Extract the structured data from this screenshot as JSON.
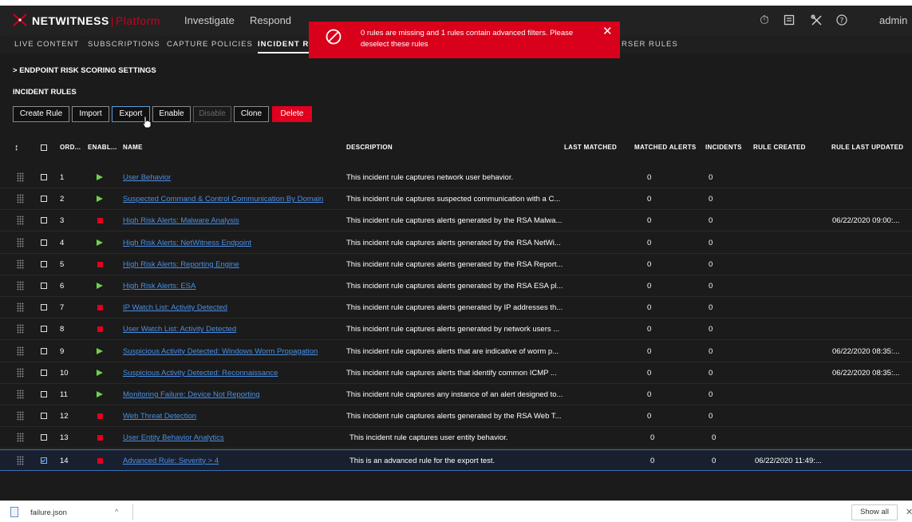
{
  "topnav": {
    "brand": "NETWITNESS",
    "brand_sep": "|",
    "brand_suffix": "Platform",
    "items": [
      "Investigate",
      "Respond"
    ],
    "user": "admin"
  },
  "subnav": {
    "items": [
      {
        "label": "LIVE CONTENT",
        "active": false
      },
      {
        "label": "SUBSCRIPTIONS",
        "active": false
      },
      {
        "label": "CAPTURE POLICIES",
        "active": false
      },
      {
        "label": "INCIDENT RULES",
        "active": true
      },
      {
        "label": "RSER RULES",
        "active": false
      }
    ]
  },
  "toast": {
    "message": "0 rules are missing and 1 rules contain advanced filters. Please deselect these rules",
    "color": "#d9001b"
  },
  "section": {
    "endpoint_link": "ENDPOINT RISK SCORING SETTINGS",
    "title": "INCIDENT RULES"
  },
  "toolbar": {
    "create": "Create Rule",
    "import": "Import",
    "export": "Export",
    "enable": "Enable",
    "disable": "Disable",
    "clone": "Clone",
    "delete": "Delete"
  },
  "table": {
    "columns": {
      "order": "ORD...",
      "enabled": "ENABL...",
      "name": "NAME",
      "description": "DESCRIPTION",
      "last_matched": "LAST MATCHED",
      "matched_alerts": "MATCHED ALERTS",
      "incidents": "INCIDENTS",
      "rule_created": "RULE CREATED",
      "rule_last_updated": "RULE LAST UPDATED"
    },
    "rows": [
      {
        "order": "1",
        "enabled": true,
        "name": "User Behavior",
        "description": "This incident rule captures network user behavior.",
        "last_matched": "",
        "matched_alerts": "0",
        "incidents": "0",
        "rule_created": "",
        "rule_last_updated": "",
        "checked": false
      },
      {
        "order": "2",
        "enabled": true,
        "name": "Suspected Command & Control Communication By Domain",
        "description": "This incident rule captures suspected communication with a C...",
        "last_matched": "",
        "matched_alerts": "0",
        "incidents": "0",
        "rule_created": "",
        "rule_last_updated": "",
        "checked": false
      },
      {
        "order": "3",
        "enabled": false,
        "name": "High Risk Alerts: Malware Analysis",
        "description": "This incident rule captures alerts generated by the RSA Malwa...",
        "last_matched": "",
        "matched_alerts": "0",
        "incidents": "0",
        "rule_created": "",
        "rule_last_updated": "06/22/2020 09:00:...",
        "checked": false
      },
      {
        "order": "4",
        "enabled": true,
        "name": "High Risk Alerts: NetWitness Endpoint",
        "description": "This incident rule captures alerts generated by the RSA NetWi...",
        "last_matched": "",
        "matched_alerts": "0",
        "incidents": "0",
        "rule_created": "",
        "rule_last_updated": "",
        "checked": false
      },
      {
        "order": "5",
        "enabled": false,
        "name": "High Risk Alerts: Reporting Engine",
        "description": "This incident rule captures alerts generated by the RSA Report...",
        "last_matched": "",
        "matched_alerts": "0",
        "incidents": "0",
        "rule_created": "",
        "rule_last_updated": "",
        "checked": false
      },
      {
        "order": "6",
        "enabled": true,
        "name": "High Risk Alerts: ESA",
        "description": "This incident rule captures alerts generated by the RSA ESA pl...",
        "last_matched": "",
        "matched_alerts": "0",
        "incidents": "0",
        "rule_created": "",
        "rule_last_updated": "",
        "checked": false
      },
      {
        "order": "7",
        "enabled": false,
        "name": "IP Watch List: Activity Detected",
        "description": "This incident rule captures alerts generated by IP addresses th...",
        "last_matched": "",
        "matched_alerts": "0",
        "incidents": "0",
        "rule_created": "",
        "rule_last_updated": "",
        "checked": false
      },
      {
        "order": "8",
        "enabled": false,
        "name": "User Watch List: Activity Detected",
        "description": "This incident rule captures alerts generated by network users ...",
        "last_matched": "",
        "matched_alerts": "0",
        "incidents": "0",
        "rule_created": "",
        "rule_last_updated": "",
        "checked": false
      },
      {
        "order": "9",
        "enabled": true,
        "name": "Suspicious Activity Detected: Windows Worm Propagation",
        "description": "This incident rule captures alerts that are indicative of worm p...",
        "last_matched": "",
        "matched_alerts": "0",
        "incidents": "0",
        "rule_created": "",
        "rule_last_updated": "06/22/2020 08:35:...",
        "checked": false
      },
      {
        "order": "10",
        "enabled": true,
        "name": "Suspicious Activity Detected: Reconnaissance",
        "description": "This incident rule captures alerts that identify common ICMP ...",
        "last_matched": "",
        "matched_alerts": "0",
        "incidents": "0",
        "rule_created": "",
        "rule_last_updated": "06/22/2020 08:35:...",
        "checked": false
      },
      {
        "order": "11",
        "enabled": true,
        "name": "Monitoring Failure: Device Not Reporting",
        "description": "This incident rule captures any instance of an alert designed to...",
        "last_matched": "",
        "matched_alerts": "0",
        "incidents": "0",
        "rule_created": "",
        "rule_last_updated": "",
        "checked": false
      },
      {
        "order": "12",
        "enabled": false,
        "name": "Web Threat Detection",
        "description": "This incident rule captures alerts generated by the RSA Web T...",
        "last_matched": "",
        "matched_alerts": "0",
        "incidents": "0",
        "rule_created": "",
        "rule_last_updated": "",
        "checked": false
      },
      {
        "order": "13",
        "enabled": false,
        "name": "User Entity Behavior Analytics",
        "description": "This incident rule captures user entity behavior.",
        "last_matched": "",
        "matched_alerts": "0",
        "incidents": "0",
        "rule_created": "",
        "rule_last_updated": "",
        "checked": false
      },
      {
        "order": "14",
        "enabled": false,
        "name": "Advanced Rule: Severity > 4",
        "description": "This is an advanced rule for the export test.",
        "last_matched": "",
        "matched_alerts": "0",
        "incidents": "0",
        "rule_created": "06/22/2020 11:49:...",
        "rule_last_updated": "",
        "checked": true
      }
    ]
  },
  "downloads": {
    "file": "failure.json",
    "show_all": "Show all"
  },
  "colors": {
    "accent_red": "#e1001e",
    "enabled_green": "#6fd14a",
    "link_blue": "#4a8fe6"
  }
}
